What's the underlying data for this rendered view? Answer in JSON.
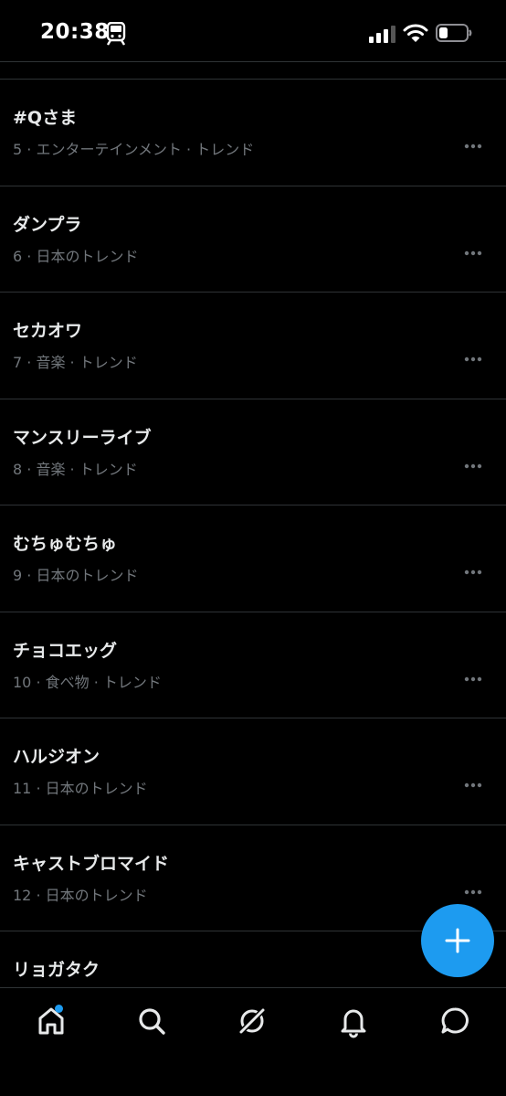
{
  "status_bar": {
    "time": "20:38"
  },
  "trends": [
    {
      "title": "",
      "meta": ""
    },
    {
      "title": "#Qさま",
      "meta": "5 · エンターテインメント · トレンド"
    },
    {
      "title": "ダンプラ",
      "meta": "6 · 日本のトレンド"
    },
    {
      "title": "セカオワ",
      "meta": "7 · 音楽 · トレンド"
    },
    {
      "title": "マンスリーライブ",
      "meta": "8 · 音楽 · トレンド"
    },
    {
      "title": "むちゅむちゅ",
      "meta": "9 · 日本のトレンド"
    },
    {
      "title": "チョコエッグ",
      "meta": "10 · 食べ物 · トレンド"
    },
    {
      "title": "ハルジオン",
      "meta": "11 · 日本のトレンド"
    },
    {
      "title": "キャストブロマイド",
      "meta": "12 · 日本のトレンド"
    },
    {
      "title": "リョガタク",
      "meta": ""
    }
  ],
  "tabs": [
    {
      "icon": "home-icon",
      "has_badge": true
    },
    {
      "icon": "search-icon",
      "has_badge": false
    },
    {
      "icon": "grok-icon",
      "has_badge": false
    },
    {
      "icon": "notifications-icon",
      "has_badge": false
    },
    {
      "icon": "messages-icon",
      "has_badge": false
    }
  ],
  "colors": {
    "accent": "#1d9bf0",
    "background": "#000000",
    "text_primary": "#e7e9ea",
    "text_secondary": "#71767b",
    "divider": "#2f3336"
  }
}
